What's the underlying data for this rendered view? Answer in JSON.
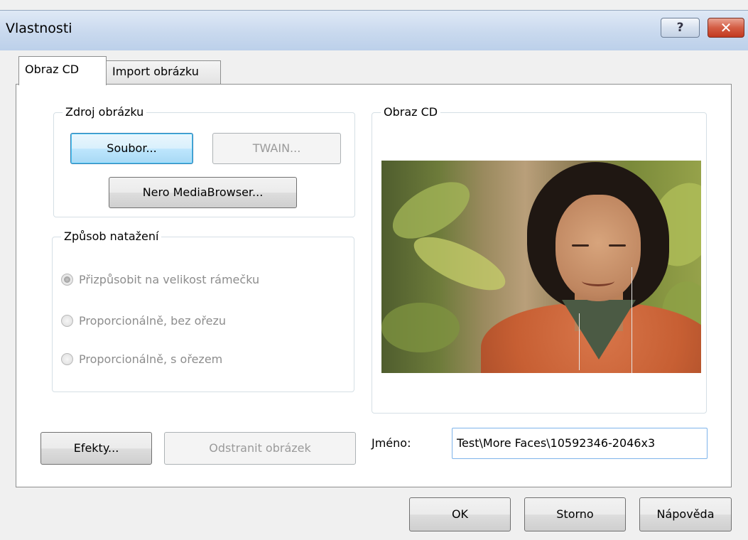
{
  "window": {
    "title": "Vlastnosti",
    "help_label": "?",
    "close_label": "✕"
  },
  "tabs": [
    {
      "label": "Obraz CD",
      "active": true
    },
    {
      "label": "Import obrázku",
      "active": false
    }
  ],
  "source_group": {
    "label": "Zdroj obrázku",
    "file_button": "Soubor...",
    "twain_button": "TWAIN...",
    "media_button": "Nero MediaBrowser..."
  },
  "stretch_group": {
    "label": "Způsob natažení",
    "options": [
      {
        "label": "Přizpůsobit na velikost rámečku",
        "checked": true
      },
      {
        "label": "Proporcionálně, bez ořezu",
        "checked": false
      },
      {
        "label": "Proporcionálně, s ořezem",
        "checked": false
      }
    ]
  },
  "preview_group": {
    "label": "Obraz CD"
  },
  "effects_button": "Efekty...",
  "remove_button": "Odstranit obrázek",
  "name_field": {
    "label": "Jméno:",
    "value": "Test\\More Faces\\10592346-2046x3"
  },
  "footer": {
    "ok_label": "OK",
    "cancel_label": "Storno",
    "help_label": "Nápověda"
  }
}
